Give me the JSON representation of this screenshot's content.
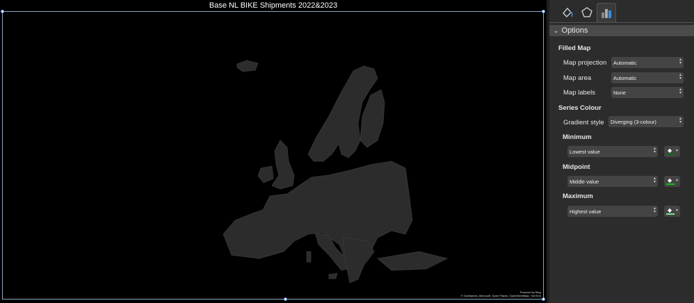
{
  "chart": {
    "title": "Base NL BIKE Shipments 2022&2023",
    "credit_line1": "Powered by Bing",
    "credit_line2": "© GeoNames, Microsoft, Open Places, OpenStreetMap, TomTom"
  },
  "panel": {
    "tabs": [
      {
        "icon": "fill-line-icon"
      },
      {
        "icon": "effects-pentagon-icon"
      },
      {
        "icon": "bar-chart-options-icon",
        "selected": true
      }
    ],
    "section": "Options",
    "filled_map": {
      "heading": "Filled Map",
      "rows": [
        {
          "label": "Map projection",
          "value": "Automatic"
        },
        {
          "label": "Map area",
          "value": "Automatic"
        },
        {
          "label": "Map labels",
          "value": "None"
        }
      ]
    },
    "series_colour": {
      "heading": "Series Colour",
      "gradient_label": "Gradient style",
      "gradient_value": "Diverging (3-colour)",
      "stops": [
        {
          "heading": "Minimum",
          "value": "Lowest value",
          "color": "#0f6e12"
        },
        {
          "heading": "Midpoint",
          "value": "Middle value",
          "color": "#12c21a"
        },
        {
          "heading": "Maximum",
          "value": "Highest value",
          "color": "#7be48a"
        }
      ]
    }
  }
}
